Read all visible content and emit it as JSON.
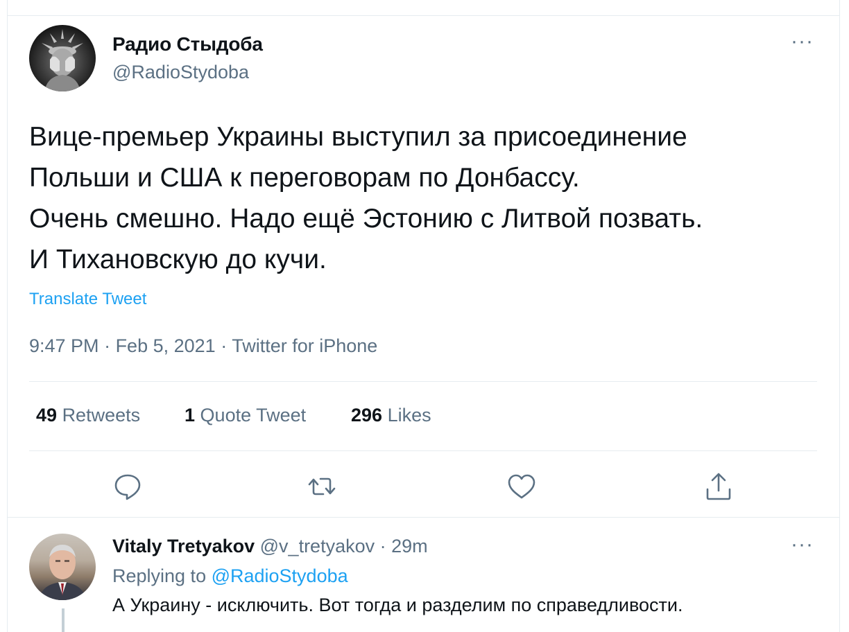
{
  "tweet": {
    "author_name": "Радио Стыдоба",
    "author_handle": "@RadioStydoba",
    "more_label": "···",
    "text_lines": [
      "Вице-премьер Украины выступил за присоединение",
      "Польши и США к переговорам по Донбассу.",
      "Очень смешно. Надо ещё Эстонию с Литвой позвать.",
      "И Тихановскую до кучи."
    ],
    "translate_label": "Translate Tweet",
    "time": "9:47 PM",
    "date": "Feb 5, 2021",
    "source": "Twitter for iPhone",
    "separator": " · "
  },
  "stats": {
    "retweets_count": "49",
    "retweets_label": "Retweets",
    "quotes_count": "1",
    "quotes_label": "Quote Tweet",
    "likes_count": "296",
    "likes_label": "Likes"
  },
  "actions": {
    "icons": [
      "reply-icon",
      "retweet-icon",
      "like-icon",
      "share-icon"
    ],
    "color": "#5b7083"
  },
  "reply": {
    "author_name": "Vitaly Tretyakov",
    "author_handle": "@v_tretyakov",
    "separator": " · ",
    "time": "29m",
    "more_label": "···",
    "replying_prefix": "Replying to ",
    "replying_to": "@RadioStydoba",
    "text": "А Украину - исключить. Вот тогда и разделим по справедливости."
  },
  "colors": {
    "link": "#1da1f2",
    "secondary_text": "#5b7083",
    "primary_text": "#0f1419",
    "divider": "#e6ecf0"
  }
}
